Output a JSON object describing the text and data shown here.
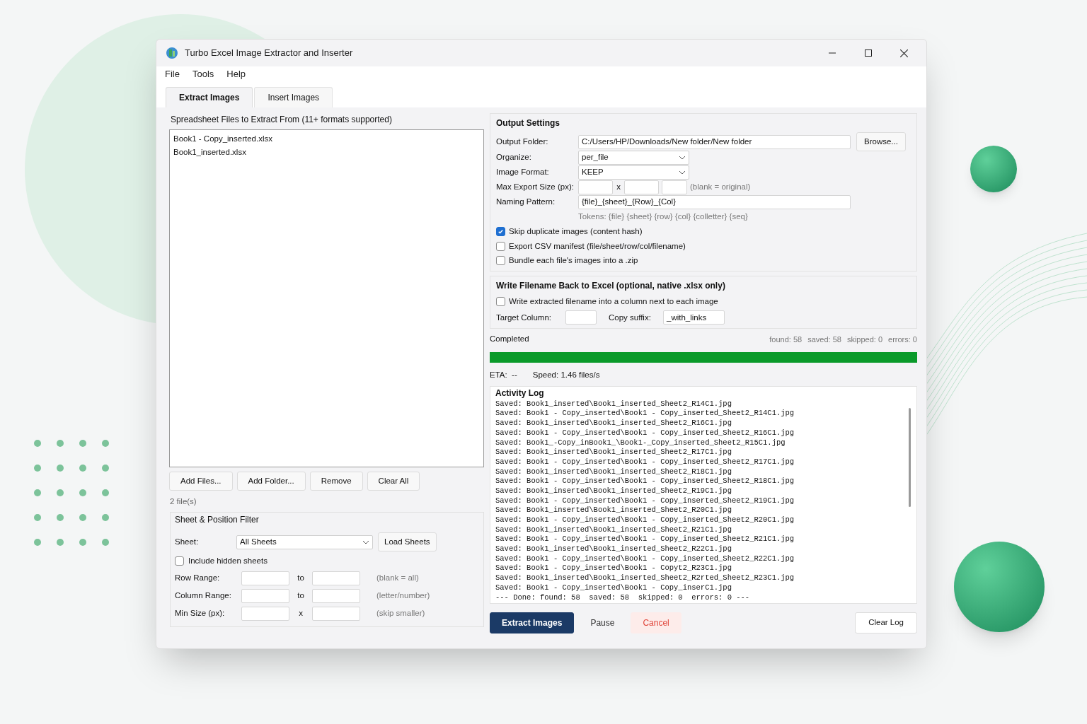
{
  "window": {
    "title": "Turbo Excel Image Extractor and Inserter"
  },
  "menu": [
    "File",
    "Tools",
    "Help"
  ],
  "tabs": [
    {
      "label": "Extract Images",
      "selected": true
    },
    {
      "label": "Insert Images",
      "selected": false
    }
  ],
  "files": {
    "label": "Spreadsheet Files to Extract From (11+ formats supported)",
    "items": [
      "Book1 - Copy_inserted.xlsx",
      "Book1_inserted.xlsx"
    ],
    "buttons": [
      "Add Files...",
      "Add Folder...",
      "Remove",
      "Clear All"
    ],
    "count": "2 file(s)"
  },
  "filter": {
    "title": "Sheet & Position Filter",
    "sheet_label": "Sheet:",
    "sheet_value": "All Sheets",
    "load_button": "Load Sheets",
    "include_hidden": {
      "label": "Include hidden sheets",
      "checked": false
    },
    "ranges": [
      {
        "label": "Row Range:",
        "separator": "to",
        "hint": "(blank = all)"
      },
      {
        "label": "Column Range:",
        "separator": "to",
        "hint": "(letter/number)"
      },
      {
        "label": "Min Size (px):",
        "separator": "x",
        "hint": "(skip smaller)"
      }
    ]
  },
  "output": {
    "title": "Output Settings",
    "folder": {
      "label": "Output Folder:",
      "value": "C:/Users/HP/Downloads/New folder/New folder",
      "button": "Browse..."
    },
    "organize": {
      "label": "Organize:",
      "value": "per_file"
    },
    "format": {
      "label": "Image Format:",
      "value": "KEEP"
    },
    "max_size": {
      "label": "Max Export Size (px):",
      "separator": "x",
      "hint": "(blank = original)"
    },
    "naming": {
      "label": "Naming Pattern:",
      "value": "{file}_{sheet}_{Row}_{Col}"
    },
    "tokens": "Tokens: {file} {sheet} {row} {col} {colletter} {seq}",
    "options": [
      {
        "label": "Skip duplicate images (content hash)",
        "checked": true
      },
      {
        "label": "Export CSV manifest (file/sheet/row/col/filename)",
        "checked": false
      },
      {
        "label": "Bundle each file's images into a .zip",
        "checked": false
      }
    ]
  },
  "write_back": {
    "title": "Write Filename Back to Excel (optional, native .xlsx only)",
    "option": {
      "label": "Write extracted filename into a column next to each image",
      "checked": false
    },
    "target_label": "Target Column:",
    "suffix_label": "Copy suffix:",
    "suffix_value": "_with_links"
  },
  "progress": {
    "status": "Completed",
    "stats": [
      "found: 58",
      "saved: 58",
      "skipped: 0",
      "errors: 0"
    ],
    "level": 1,
    "eta": "ETA:  --",
    "speed": "Speed: 1.46 files/s"
  },
  "log": {
    "title": "Activity Log",
    "lines": [
      "Saved: Book1_inserted\\Book1_inserted_Sheet2_R14C1.jpg",
      "Saved: Book1 - Copy_inserted\\Book1 - Copy_inserted_Sheet2_R14C1.jpg",
      "Saved: Book1_inserted\\Book1_inserted_Sheet2_R16C1.jpg",
      "Saved: Book1 - Copy_inserted\\Book1 - Copy_inserted_Sheet2_R16C1.jpg",
      "Saved: Book1_-Copy_inBook1_\\Book1-_Copy_inserted_Sheet2_R15C1.jpg",
      "Saved: Book1_inserted\\Book1_inserted_Sheet2_R17C1.jpg",
      "Saved: Book1 - Copy_inserted\\Book1 - Copy_inserted_Sheet2_R17C1.jpg",
      "Saved: Book1_inserted\\Book1_inserted_Sheet2_R18C1.jpg",
      "Saved: Book1 - Copy_inserted\\Book1 - Copy_inserted_Sheet2_R18C1.jpg",
      "Saved: Book1_inserted\\Book1_inserted_Sheet2_R19C1.jpg",
      "Saved: Book1 - Copy_inserted\\Book1 - Copy_inserted_Sheet2_R19C1.jpg",
      "Saved: Book1_inserted\\Book1_inserted_Sheet2_R20C1.jpg",
      "Saved: Book1 - Copy_inserted\\Book1 - Copy_inserted_Sheet2_R20C1.jpg",
      "Saved: Book1_inserted\\Book1_inserted_Sheet2_R21C1.jpg",
      "Saved: Book1 - Copy_inserted\\Book1 - Copy_inserted_Sheet2_R21C1.jpg",
      "Saved: Book1_inserted\\Book1_inserted_Sheet2_R22C1.jpg",
      "Saved: Book1 - Copy_inserted\\Book1 - Copy_inserted_Sheet2_R22C1.jpg",
      "Saved: Book1 - Copy_inserted\\Book1 - Copyt2_R23C1.jpg",
      "Saved: Book1_inserted\\Book1_inserted_Sheet2_R2rted_Sheet2_R23C1.jpg",
      "Saved: Book1 - Copy_inserted\\Book1 - Copy_inserC1.jpg",
      "--- Done: found: 58  saved: 58  skipped: 0  errors: 0 ---"
    ]
  },
  "actions": [
    {
      "label": "Extract Images",
      "kind": "primary"
    },
    {
      "label": "Pause",
      "kind": "plain"
    },
    {
      "label": "Cancel",
      "kind": "danger"
    }
  ],
  "clear_log": "Clear Log"
}
